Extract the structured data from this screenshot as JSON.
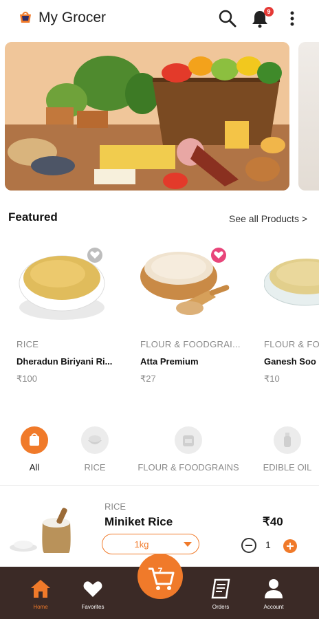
{
  "app": {
    "title": "My Grocer",
    "notification_count": "9"
  },
  "featured": {
    "title": "Featured",
    "see_all": "See all Products >",
    "products": [
      {
        "category": "RICE",
        "name": "Dheradun Biriyani Ri...",
        "price": "₹100",
        "favorited": false
      },
      {
        "category": "FLOUR & FOODGRAI...",
        "name": "Atta Premium",
        "price": "₹27",
        "favorited": true
      },
      {
        "category": "FLOUR & FO",
        "name": "Ganesh Soo",
        "price": "₹10",
        "favorited": false
      }
    ]
  },
  "categories": [
    {
      "label": "All",
      "selected": true,
      "icon": "shopping-bag-icon"
    },
    {
      "label": "RICE",
      "selected": false,
      "icon": "rice-bowl-icon"
    },
    {
      "label": "FLOUR & FOODGRAINS",
      "selected": false,
      "icon": "flour-sack-icon"
    },
    {
      "label": "EDIBLE OIL",
      "selected": false,
      "icon": "oil-bottle-icon"
    }
  ],
  "list_item": {
    "category": "RICE",
    "name": "Miniket Rice",
    "price": "₹40",
    "weight": "1kg",
    "quantity": "1"
  },
  "bottom_nav": {
    "home": "Home",
    "favorites": "Favorites",
    "cart_count": "7",
    "orders": "Orders",
    "account": "Account"
  },
  "colors": {
    "accent": "#f07a2a",
    "nav_bg": "#3b2a26",
    "badge": "#e53935"
  }
}
